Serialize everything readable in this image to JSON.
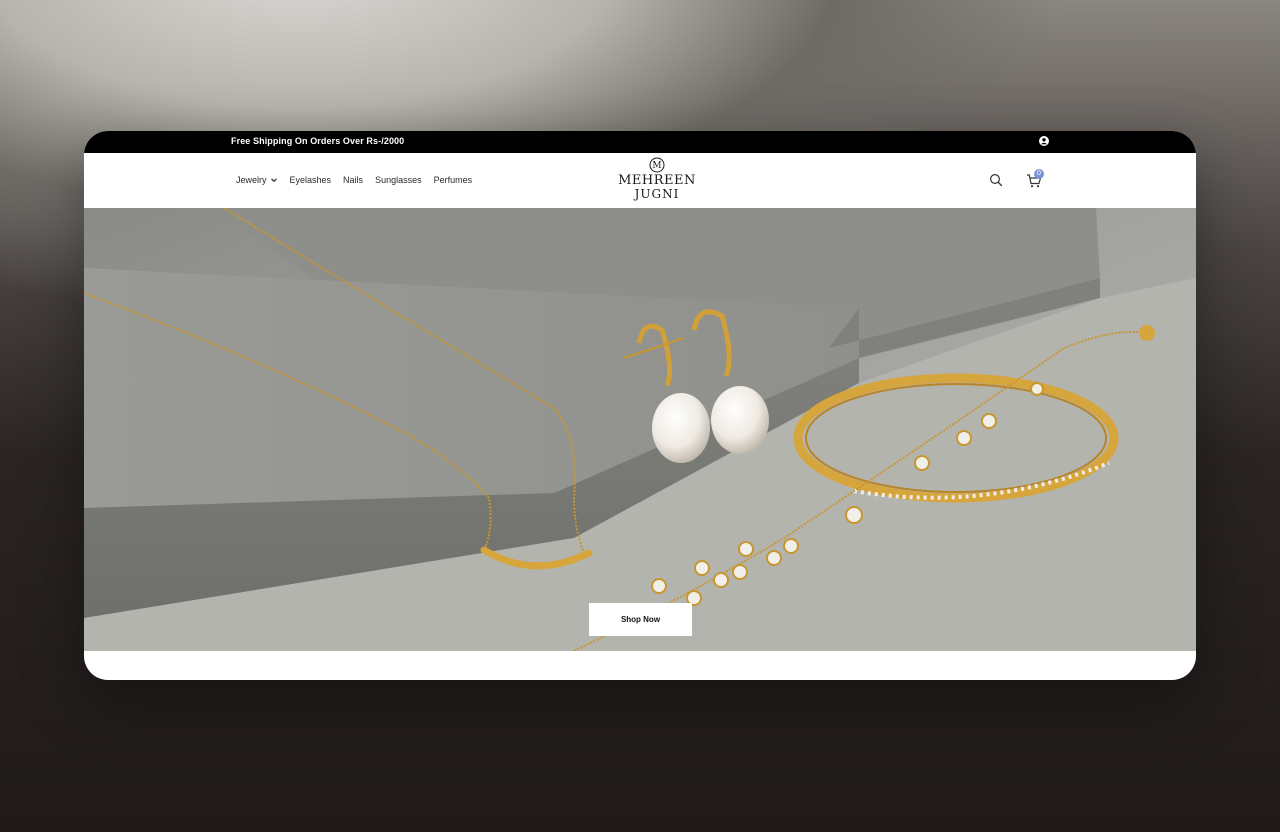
{
  "announcement": {
    "text": "Free Shipping On Orders Over Rs-/2000"
  },
  "nav": {
    "items": [
      {
        "label": "Jewelry",
        "has_dropdown": true
      },
      {
        "label": "Eyelashes"
      },
      {
        "label": "Nails"
      },
      {
        "label": "Sunglasses"
      },
      {
        "label": "Perfumes"
      }
    ]
  },
  "logo": {
    "mark": "M",
    "line1": "MEHREEN",
    "line2": "JUGNI"
  },
  "header": {
    "search_icon": "search-icon",
    "cart_icon": "cart-icon",
    "account_icon": "user-icon",
    "cart_count": "0"
  },
  "hero": {
    "button_label": "Shop Now"
  },
  "colors": {
    "topbar": "#000000",
    "cart_badge": "#7b93d6",
    "gold": "#d6a53c"
  }
}
